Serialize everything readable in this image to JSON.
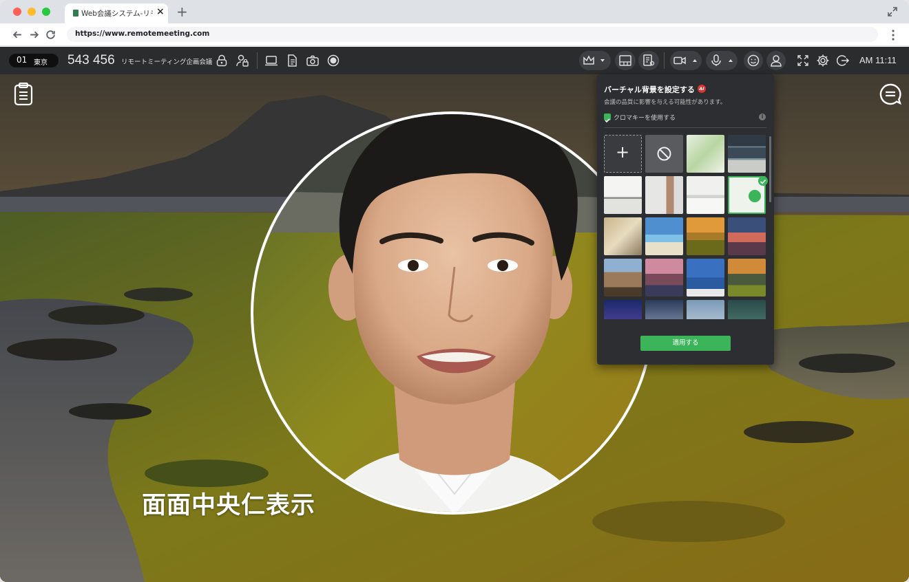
{
  "browser": {
    "tab_title": "Web会議システム-リモ...",
    "url": "https://www.remotemeeting.com"
  },
  "toolbar": {
    "room_number": "01",
    "room_city": "東京",
    "meeting_id": "543 456",
    "meeting_name": "リモートミーティング企画会議",
    "clock": "AM 11:11"
  },
  "stage": {
    "caption": "面面中央仁表示"
  },
  "vb_panel": {
    "title": "バーチャル背景を設定する",
    "ai_badge": "AI",
    "warning": "会議の品質に影響を与える可能性があります。",
    "chroma_label": "クロマキーを使用する",
    "apply_label": "適用する",
    "add_symbol": "+",
    "selected_index": 7
  },
  "colors": {
    "toolbar_bg": "#2b2c2e",
    "accent_green": "#3cb55a",
    "panel_bg": "#2d2e31"
  }
}
